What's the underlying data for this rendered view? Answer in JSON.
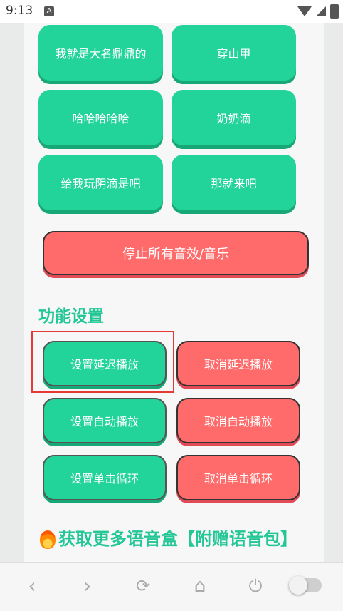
{
  "status_bar": {
    "time": "9:13",
    "notification": "A"
  },
  "sound_buttons": [
    "我就是大名鼎鼎的",
    "穿山甲",
    "哈哈哈哈哈",
    "奶奶滴",
    "给我玩阴滴是吧",
    "那就来吧"
  ],
  "stop_all_label": "停止所有音效/音乐",
  "function_section": {
    "title": "功能设置",
    "set_delay": "设置延迟播放",
    "cancel_delay": "取消延迟播放",
    "set_auto": "设置自动播放",
    "cancel_auto": "取消自动播放",
    "set_loop": "设置单击循环",
    "cancel_loop": "取消单击循环"
  },
  "more_title": "获取更多语音盒【附赠语音包】",
  "nav": {
    "back": "‹",
    "forward": "›",
    "reload": "⟳",
    "home": "⌂",
    "power": "⏻"
  },
  "colors": {
    "accent": "#22d39a",
    "danger": "#ff6b6b",
    "title": "#22c795"
  }
}
